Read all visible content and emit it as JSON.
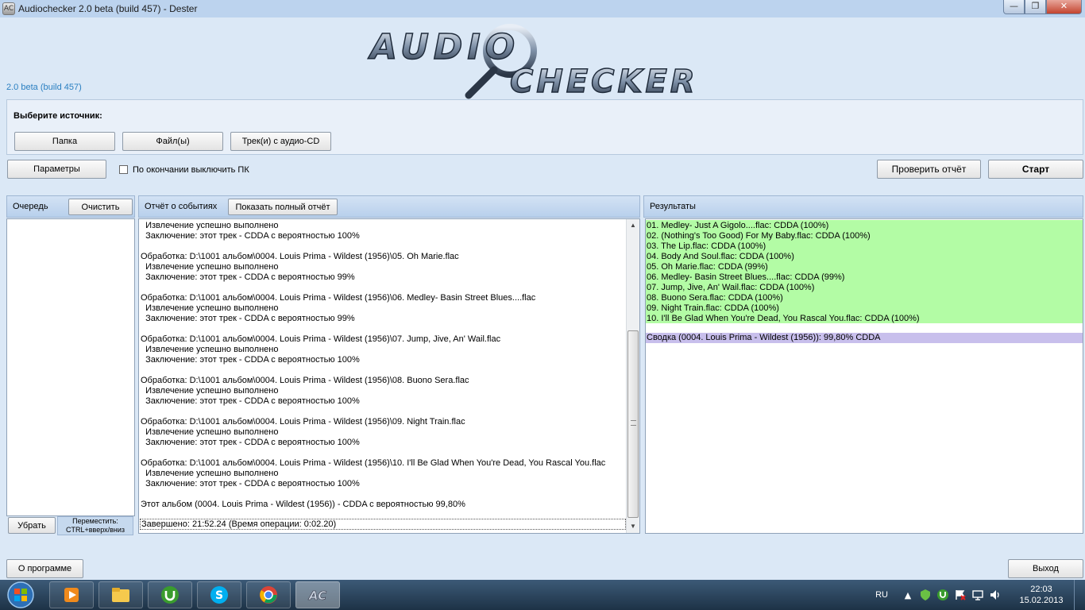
{
  "window": {
    "title": "Audiochecker 2.0 beta (build 457) - Dester",
    "app_icon_glyph": "AC",
    "minimize_glyph": "—",
    "maximize_glyph": "❐",
    "close_glyph": "✕"
  },
  "logo": {
    "line1": "AUDIO",
    "line2": "CHECKER"
  },
  "version_label": "2.0 beta (build 457)",
  "source": {
    "label": "Выберите источник:",
    "folder_button": "Папка",
    "files_button": "Файл(ы)",
    "cd_button": "Трек(и) с аудио-CD"
  },
  "options": {
    "params_button": "Параметры",
    "shutdown_checkbox_label": "По окончании выключить ПК",
    "shutdown_checked": false,
    "check_report_button": "Проверить отчёт",
    "start_button": "Старт"
  },
  "queue": {
    "header": "Очередь",
    "clear_button": "Очистить",
    "remove_button": "Убрать",
    "move_hint_line1": "Переместить:",
    "move_hint_line2": "CTRL+вверх/вниз"
  },
  "events": {
    "header": "Отчёт о событиях",
    "show_full_button": "Показать полный отчёт",
    "lines": [
      "  Извлечение успешно выполнено",
      "  Заключение: этот трек - CDDA с вероятностью 100%",
      "",
      "Обработка: D:\\1001 альбом\\0004. Louis Prima - Wildest (1956)\\05. Oh Marie.flac",
      "  Извлечение успешно выполнено",
      "  Заключение: этот трек - CDDA с вероятностью 99%",
      "",
      "Обработка: D:\\1001 альбом\\0004. Louis Prima - Wildest (1956)\\06. Medley- Basin Street Blues....flac",
      "  Извлечение успешно выполнено",
      "  Заключение: этот трек - CDDA с вероятностью 99%",
      "",
      "Обработка: D:\\1001 альбом\\0004. Louis Prima - Wildest (1956)\\07. Jump, Jive, An' Wail.flac",
      "  Извлечение успешно выполнено",
      "  Заключение: этот трек - CDDA с вероятностью 100%",
      "",
      "Обработка: D:\\1001 альбом\\0004. Louis Prima - Wildest (1956)\\08. Buono Sera.flac",
      "  Извлечение успешно выполнено",
      "  Заключение: этот трек - CDDA с вероятностью 100%",
      "",
      "Обработка: D:\\1001 альбом\\0004. Louis Prima - Wildest (1956)\\09. Night Train.flac",
      "  Извлечение успешно выполнено",
      "  Заключение: этот трек - CDDA с вероятностью 100%",
      "",
      "Обработка: D:\\1001 альбом\\0004. Louis Prima - Wildest (1956)\\10. I'll Be Glad When You're Dead, You Rascal You.flac",
      "  Извлечение успешно выполнено",
      "  Заключение: этот трек - CDDA с вероятностью 100%",
      "",
      "Этот альбом (0004. Louis Prima - Wildest (1956)) - CDDA с вероятностью 99,80%"
    ],
    "status": "Завершено: 21:52.24 (Время операции: 0:02.20)",
    "scroll_up_glyph": "▲",
    "scroll_down_glyph": "▼"
  },
  "results": {
    "header": "Результаты",
    "highlight_color": "#b3fca5",
    "summary_color": "#c8bfec",
    "lines": [
      "01. Medley- Just A Gigolo....flac: CDDA (100%)",
      "02. (Nothing's Too Good) For My Baby.flac: CDDA (100%)",
      "03. The Lip.flac: CDDA (100%)",
      "04. Body And Soul.flac: CDDA (100%)",
      "05. Oh Marie.flac: CDDA (99%)",
      "06. Medley- Basin Street Blues....flac: CDDA (99%)",
      "07. Jump, Jive, An' Wail.flac: CDDA (100%)",
      "08. Buono Sera.flac: CDDA (100%)",
      "09. Night Train.flac: CDDA (100%)",
      "10. I'll Be Glad When You're Dead, You Rascal You.flac: CDDA (100%)"
    ],
    "summary": "Сводка (0004. Louis Prima - Wildest (1956)): 99,80% CDDA"
  },
  "footer": {
    "about_button": "О программе",
    "exit_button": "Выход"
  },
  "taskbar": {
    "lang": "RU",
    "time": "22:03",
    "date": "15.02.2013",
    "apps": [
      {
        "name": "media-player-icon"
      },
      {
        "name": "explorer-icon"
      },
      {
        "name": "utorrent-icon"
      },
      {
        "name": "skype-icon"
      },
      {
        "name": "chrome-icon"
      },
      {
        "name": "audiochecker-icon"
      }
    ]
  }
}
